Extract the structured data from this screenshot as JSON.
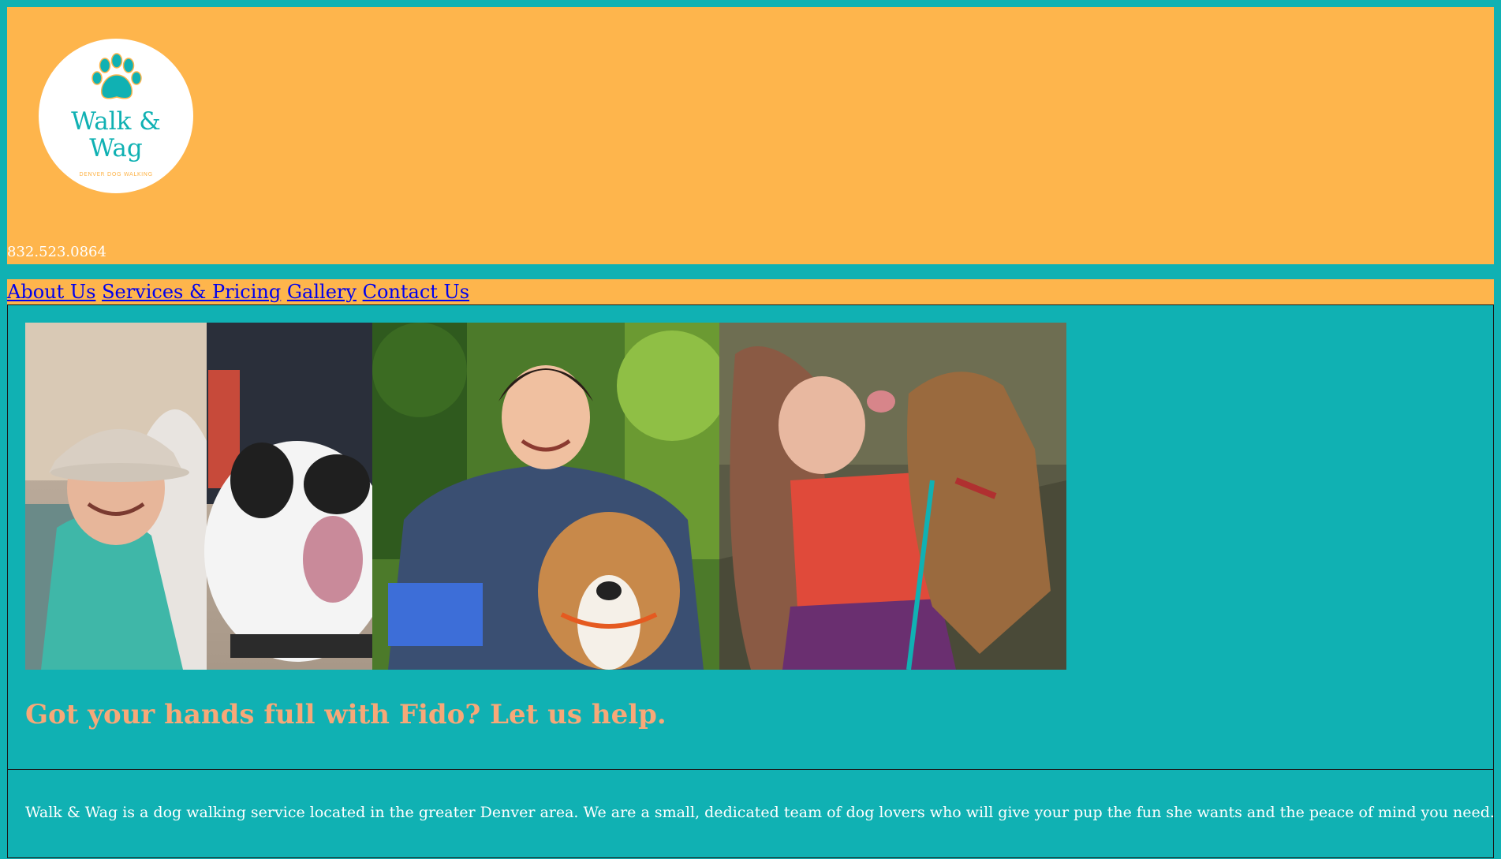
{
  "header": {
    "logo": {
      "title": "Walk &\nWag",
      "tagline": "DENVER DOG WALKING",
      "icon": "paw-print-icon"
    },
    "phone": "832.523.0864"
  },
  "nav": {
    "items": [
      {
        "label": "About Us"
      },
      {
        "label": "Services & Pricing"
      },
      {
        "label": "Gallery"
      },
      {
        "label": "Contact Us"
      }
    ]
  },
  "hero": {
    "photos": [
      {
        "subject": "woman-with-cap-and-black-white-dog"
      },
      {
        "subject": "woman-in-hoodie-with-tan-dog"
      },
      {
        "subject": "girl-being-licked-by-brown-dog"
      }
    ],
    "tagline": "Got your hands full with Fido? Let us help."
  },
  "about": {
    "text": "Walk & Wag is a dog walking service located in the greater Denver area. We are a small, dedicated team of dog lovers who will give your pup the fun she wants and the peace of mind you need."
  },
  "colors": {
    "page_bg": "#10B1B3",
    "header_bg": "#FEB54C",
    "tagline": "#F7A878",
    "link": "#0000EE",
    "text_light": "#FFFFFF"
  }
}
